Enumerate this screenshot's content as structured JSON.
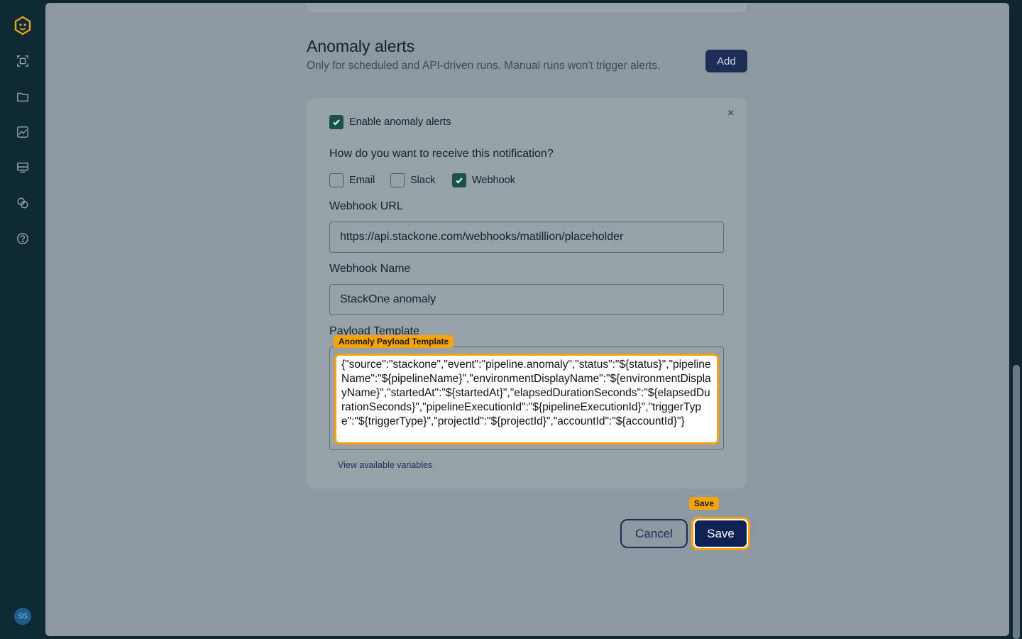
{
  "sidebar": {
    "avatar_initials": "SS",
    "icons": [
      "logo-icon",
      "scan-icon",
      "folder-icon",
      "chart-icon",
      "server-icon",
      "link-icon",
      "help-icon"
    ]
  },
  "section": {
    "title": "Anomaly alerts",
    "subtitle": "Only for scheduled and API-driven runs. Manual runs won't trigger alerts.",
    "add_label": "Add"
  },
  "card": {
    "close_label": "×",
    "enable_label": "Enable anomaly alerts",
    "enable_checked": true,
    "question": "How do you want to receive this notification?",
    "channels": [
      {
        "label": "Email",
        "checked": false
      },
      {
        "label": "Slack",
        "checked": false
      },
      {
        "label": "Webhook",
        "checked": true
      }
    ],
    "webhook_url_label": "Webhook URL",
    "webhook_url_value": "https://api.stackone.com/webhooks/matillion/placeholder",
    "webhook_name_label": "Webhook Name",
    "webhook_name_value": "StackOne anomaly",
    "payload_label": "Payload Template",
    "payload_tag": "Anomaly Payload Template",
    "payload_value": "{\"source\":\"stackone\",\"event\":\"pipeline.anomaly\",\"status\":\"${status}\",\"pipelineName\":\"${pipelineName}\",\"environmentDisplayName\":\"${environmentDisplayName}\",\"startedAt\":\"${startedAt}\",\"elapsedDurationSeconds\":\"${elapsedDurationSeconds}\",\"pipelineExecutionId\":\"${pipelineExecutionId}\",\"triggerType\":\"${triggerType}\",\"projectId\":\"${projectId}\",\"accountId\":\"${accountId}\"}",
    "view_variables_label": "View available variables"
  },
  "footer": {
    "cancel_label": "Cancel",
    "save_label": "Save",
    "save_tag": "Save"
  },
  "colors": {
    "accent_highlight": "#f5a40e",
    "primary_button": "#0f2152",
    "checkbox_checked": "#1b5147"
  }
}
